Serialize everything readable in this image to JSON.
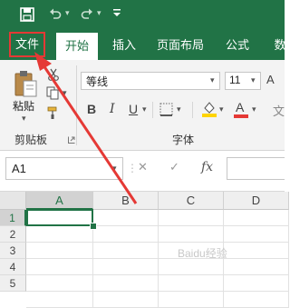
{
  "quick_access": {
    "icons": [
      "save-icon",
      "undo-icon",
      "redo-icon",
      "customize-icon"
    ]
  },
  "tabs": [
    {
      "label": "文件"
    },
    {
      "label": "开始"
    },
    {
      "label": "插入"
    },
    {
      "label": "页面布局"
    },
    {
      "label": "公式"
    },
    {
      "label": "数"
    }
  ],
  "ribbon": {
    "clipboard": {
      "paste_label": "粘贴",
      "group_label": "剪贴板"
    },
    "font": {
      "font_name": "等线",
      "font_size": "11",
      "group_label": "字体",
      "bold": "B",
      "italic": "I",
      "underline": "U",
      "increase_size": "A",
      "decrease_size": "A",
      "font_color_letter": "A"
    }
  },
  "formula_bar": {
    "name_box": "A1",
    "cancel": "✕",
    "enter": "✓",
    "fx": "fx"
  },
  "grid": {
    "columns": [
      "A",
      "B",
      "C",
      "D"
    ],
    "rows": [
      "1",
      "2",
      "3",
      "4",
      "5",
      "6"
    ],
    "active_cell": "A1"
  },
  "watermark": "Baidu经验",
  "colors": {
    "excel_green": "#217346",
    "highlight_red": "#e53935",
    "ribbon_bg": "#f3f3f3"
  }
}
